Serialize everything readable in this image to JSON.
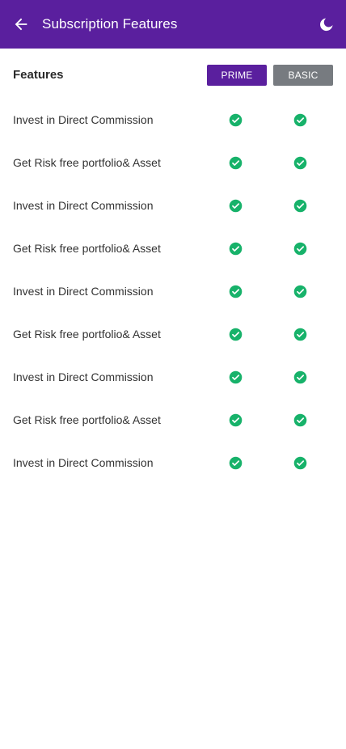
{
  "appbar": {
    "title": "Subscription Features",
    "back_icon": "arrow-left-icon",
    "theme_icon": "moon-icon",
    "color": "#5a1f9e"
  },
  "table": {
    "heading": "Features",
    "plans": [
      {
        "label": "PRIME",
        "color": "#5a1f9e"
      },
      {
        "label": "BASIC",
        "color": "#777b80"
      }
    ],
    "check_color": "#17b26a",
    "rows": [
      {
        "label": "Invest in Direct Commission",
        "prime": true,
        "basic": true
      },
      {
        "label": "Get Risk free portfolio& Asset",
        "prime": true,
        "basic": true
      },
      {
        "label": "Invest in Direct Commission",
        "prime": true,
        "basic": true
      },
      {
        "label": "Get Risk free portfolio& Asset",
        "prime": true,
        "basic": true
      },
      {
        "label": "Invest in Direct Commission",
        "prime": true,
        "basic": true
      },
      {
        "label": "Get Risk free portfolio& Asset",
        "prime": true,
        "basic": true
      },
      {
        "label": "Invest in Direct Commission",
        "prime": true,
        "basic": true
      },
      {
        "label": "Get Risk free portfolio& Asset",
        "prime": true,
        "basic": true
      },
      {
        "label": "Invest in Direct Commission",
        "prime": true,
        "basic": true
      }
    ]
  }
}
